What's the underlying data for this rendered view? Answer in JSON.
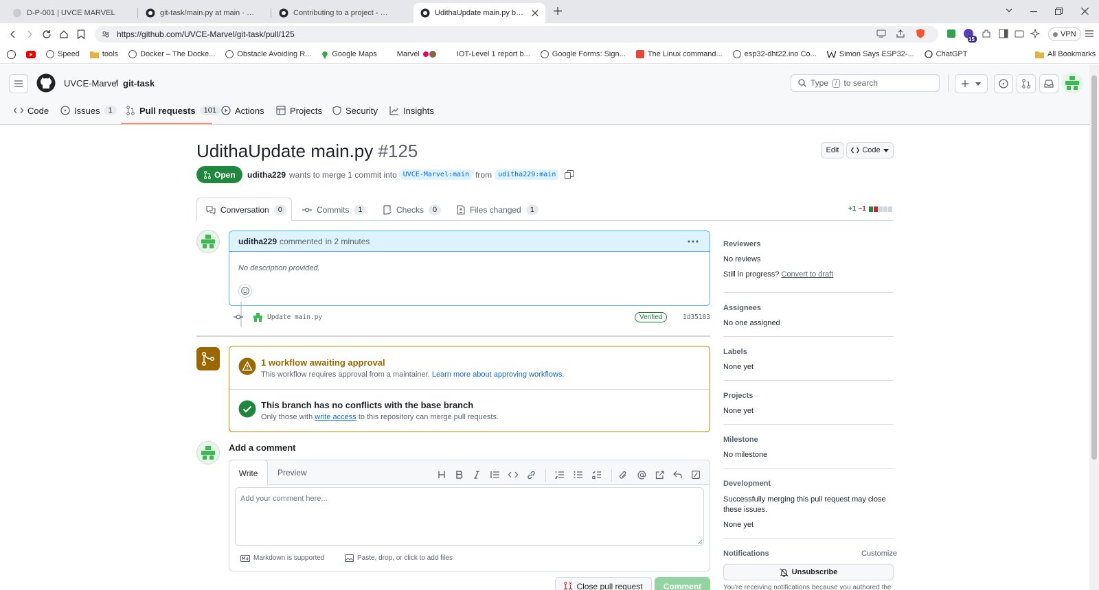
{
  "browser": {
    "tabs": [
      {
        "title": "D-P-001 | UVCE MARVEL",
        "active": false
      },
      {
        "title": "git-task/main.py at main · UVCE-Ma",
        "active": false
      },
      {
        "title": "Contributing to a project - GitHub D",
        "active": false
      },
      {
        "title": "UdithaUpdate main.py by udit",
        "active": true
      }
    ],
    "url": "https://github.com/UVCE-Marvel/git-task/pull/125",
    "vpn_label": "VPN",
    "extension_badge": "15",
    "bookmarks": [
      "Speed",
      "tools",
      "Docker – The Docke...",
      "Obstacle Avoiding R...",
      "Google Maps",
      "Marvel",
      "IOT-Level 1 report b...",
      "Google Forms: Sign...",
      "The Linux command...",
      "esp32-dht22.ino Co...",
      "Simon Says ESP32-...",
      "ChatGPT"
    ],
    "all_bookmarks": "All Bookmarks"
  },
  "header": {
    "owner": "UVCE-Marvel",
    "separator": "/",
    "repo": "git-task",
    "search_placeholder": "Type / to search",
    "search_key": "/",
    "search_prefix": "Type",
    "search_suffix": "to search"
  },
  "repo_tabs": [
    {
      "label": "Code",
      "count": null
    },
    {
      "label": "Issues",
      "count": "1"
    },
    {
      "label": "Pull requests",
      "count": "101"
    },
    {
      "label": "Actions",
      "count": null
    },
    {
      "label": "Projects",
      "count": null
    },
    {
      "label": "Security",
      "count": null
    },
    {
      "label": "Insights",
      "count": null
    }
  ],
  "pr": {
    "title": "UdithaUpdate main.py",
    "number": "#125",
    "edit_label": "Edit",
    "code_label": "Code",
    "state": "Open",
    "author": "uditha229",
    "merge_text": "wants to merge 1 commit into",
    "base_branch": "UVCE-Marvel:main",
    "from_text": "from",
    "head_branch": "uditha229:main",
    "tabs": [
      {
        "label": "Conversation",
        "count": "0"
      },
      {
        "label": "Commits",
        "count": "1"
      },
      {
        "label": "Checks",
        "count": "0"
      },
      {
        "label": "Files changed",
        "count": "1"
      }
    ],
    "diff_add": "+1",
    "diff_del": "−1"
  },
  "comment": {
    "author": "uditha229",
    "action": "commented",
    "time": "in 2 minutes",
    "body": "No description provided."
  },
  "commit": {
    "message": "Update main.py",
    "badge": "Verified",
    "sha": "1d35183"
  },
  "merge_box": {
    "workflow_title": "1 workflow awaiting approval",
    "workflow_desc": "This workflow requires approval from a maintainer.",
    "workflow_link": "Learn more about approving workflows.",
    "conflict_title": "This branch has no conflicts with the base branch",
    "conflict_desc_pre": "Only those with",
    "conflict_link": "write access",
    "conflict_desc_post": "to this repository can merge pull requests."
  },
  "new_comment": {
    "heading": "Add a comment",
    "write_tab": "Write",
    "preview_tab": "Preview",
    "placeholder": "Add your comment here...",
    "markdown_note": "Markdown is supported",
    "attach_note": "Paste, drop, or click to add files",
    "close_button": "Close pull request",
    "comment_button": "Comment"
  },
  "sidebar": {
    "reviewers_h": "Reviewers",
    "reviewers_v": "No reviews",
    "progress_pre": "Still in progress?",
    "progress_link": "Convert to draft",
    "assignees_h": "Assignees",
    "assignees_v": "No one assigned",
    "labels_h": "Labels",
    "labels_v": "None yet",
    "projects_h": "Projects",
    "projects_v": "None yet",
    "milestone_h": "Milestone",
    "milestone_v": "No milestone",
    "development_h": "Development",
    "development_v": "Successfully merging this pull request may close these issues.",
    "development_v2": "None yet",
    "notifications_h": "Notifications",
    "customize": "Customize",
    "unsubscribe": "Unsubscribe",
    "notif_note": "You're receiving notifications because you authored the"
  },
  "colors": {
    "open_green": "#1f883d",
    "accent_blue": "#0969da",
    "warning_brown": "#9a6700",
    "active_tab_underline": "#fd8c73"
  }
}
